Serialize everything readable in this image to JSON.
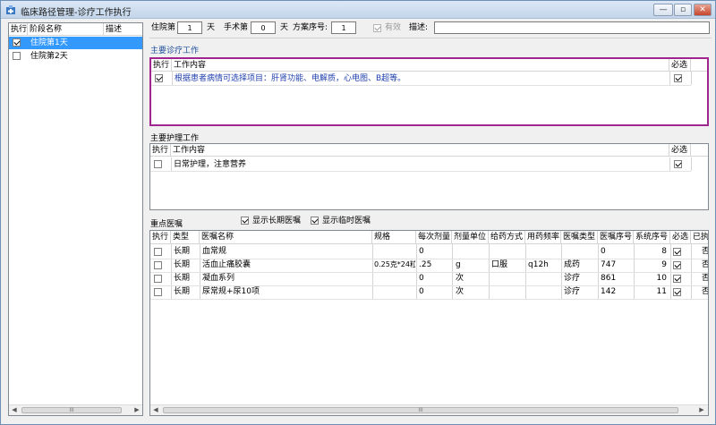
{
  "window": {
    "title": "临床路径管理-诊疗工作执行",
    "controls": {
      "minimize": "—",
      "restore": "▫",
      "close": "✕"
    }
  },
  "stages": {
    "headers": [
      "执行",
      "阶段名称",
      "描述"
    ],
    "rows": [
      {
        "checked": true,
        "name": "住院第1天",
        "desc": ""
      },
      {
        "checked": false,
        "name": "住院第2天",
        "desc": ""
      }
    ],
    "scroll_thumb": "III"
  },
  "form": {
    "day_prefix": "住院第",
    "day_value": "1",
    "day_suffix": "天",
    "surgery_prefix": "手术第",
    "surgery_value": "0",
    "surgery_suffix": "天",
    "plan_label": "方案序号:",
    "plan_value": "1",
    "valid_label": "有效",
    "valid_checked": true,
    "desc_label": "描述:",
    "desc_value": ""
  },
  "diagnosis": {
    "title": "主要诊疗工作",
    "headers": {
      "exec": "执行",
      "content": "工作内容",
      "required": "必选"
    },
    "rows": [
      {
        "checked": true,
        "content": "根据患者病情可选择项目：肝肾功能、电解质，心电图、B超等。",
        "required": true
      }
    ]
  },
  "nursing": {
    "title": "主要护理工作",
    "headers": {
      "exec": "执行",
      "content": "工作内容",
      "required": "必选"
    },
    "rows": [
      {
        "checked": false,
        "content": "日常护理，注意营养",
        "required": true
      }
    ]
  },
  "orders": {
    "title": "重点医嘱",
    "show_long": {
      "label": "显示长期医嘱",
      "checked": true
    },
    "show_temp": {
      "label": "显示临时医嘱",
      "checked": true
    },
    "headers": [
      "执行",
      "类型",
      "医嘱名称",
      "规格",
      "每次剂量",
      "剂量单位",
      "给药方式",
      "用药频率",
      "医嘱类型",
      "医嘱序号",
      "系统序号",
      "必选",
      "已执"
    ],
    "rows": [
      {
        "checked": false,
        "type": "长期",
        "name": "血常规",
        "spec": "",
        "dose": "0",
        "unit": "",
        "route": "",
        "freq": "",
        "order_type": "",
        "order_no": "0",
        "sys_no": "8",
        "required": true,
        "done": "否"
      },
      {
        "checked": false,
        "type": "长期",
        "name": "活血止痛胶囊",
        "spec": "0.25克*24粒",
        "dose": ".25",
        "unit": "g",
        "route": "口服",
        "freq": "q12h",
        "order_type": "成药",
        "order_no": "747",
        "sys_no": "9",
        "required": true,
        "done": "否"
      },
      {
        "checked": false,
        "type": "长期",
        "name": "凝血系列",
        "spec": "",
        "dose": "0",
        "unit": "次",
        "route": "",
        "freq": "",
        "order_type": "诊疗",
        "order_no": "861",
        "sys_no": "10",
        "required": true,
        "done": "否"
      },
      {
        "checked": false,
        "type": "长期",
        "name": "尿常规+尿10项",
        "spec": "",
        "dose": "0",
        "unit": "次",
        "route": "",
        "freq": "",
        "order_type": "诊疗",
        "order_no": "142",
        "sys_no": "11",
        "required": true,
        "done": "否"
      }
    ],
    "scroll_thumb": "III"
  },
  "colors": {
    "selection": "#3399ff",
    "section_title": "#1f4e9c",
    "highlight_border": "#a0258f",
    "diagnosis_text": "#1f3fae"
  }
}
